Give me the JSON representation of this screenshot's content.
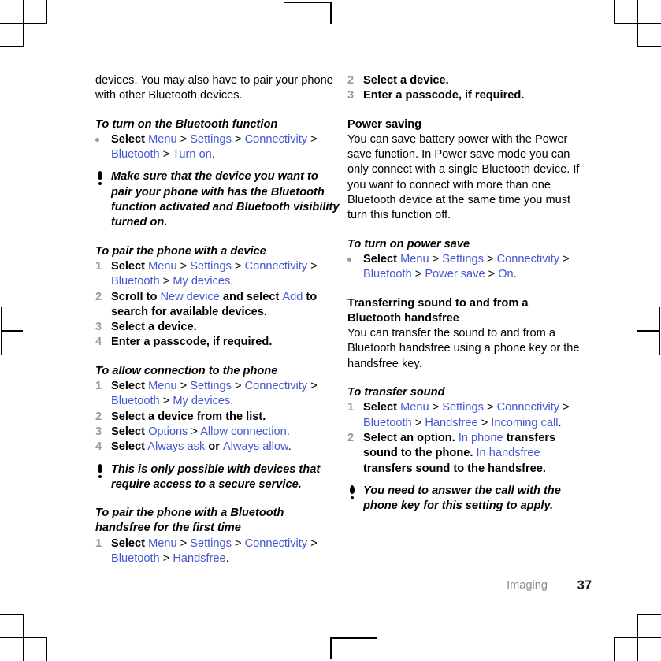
{
  "document": {
    "footer": {
      "chapter": "Imaging",
      "page_number": "37"
    },
    "colors": {
      "link": "#4257cf",
      "step_number": "#9a9a9a",
      "chapter_text": "#8c8c8c",
      "body_text": "#000000"
    }
  },
  "left_column": {
    "intro_paragraph": "devices. You may also have to pair your phone with other Bluetooth devices.",
    "section_turn_on_bluetooth": {
      "heading": "To turn on the Bluetooth function",
      "step": {
        "marker": "bullet",
        "verb": "Select",
        "path": [
          "Menu",
          "Settings",
          "Connectivity",
          "Bluetooth",
          "Turn on"
        ],
        "terminator": "."
      }
    },
    "note_visibility": "Make sure that the device you want to pair your phone with has the Bluetooth function activated and Bluetooth visibility turned on.",
    "section_pair_device": {
      "heading": "To pair the phone with a device",
      "steps": [
        {
          "number": "1",
          "verb": "Select",
          "path": [
            "Menu",
            "Settings",
            "Connectivity",
            "Bluetooth",
            "My devices"
          ],
          "terminator": "."
        },
        {
          "number": "2",
          "text_pre": "Scroll to ",
          "link_1": "New device",
          "text_mid": " and select ",
          "link_2": "Add",
          "text_post": " to search for available devices."
        },
        {
          "number": "3",
          "text": "Select a device."
        },
        {
          "number": "4",
          "text": "Enter a passcode, if required."
        }
      ]
    },
    "section_allow_connection": {
      "heading": "To allow connection to the phone",
      "steps": [
        {
          "number": "1",
          "verb": "Select",
          "path": [
            "Menu",
            "Settings",
            "Connectivity",
            "Bluetooth",
            "My devices"
          ],
          "terminator": "."
        },
        {
          "number": "2",
          "text": "Select a device from the list."
        },
        {
          "number": "3",
          "verb": "Select",
          "path": [
            "Options",
            "Allow connection"
          ],
          "terminator": "."
        },
        {
          "number": "4",
          "verb": "Select",
          "link_1": "Always ask",
          "conjunction": " or ",
          "link_2": "Always allow",
          "terminator": "."
        }
      ]
    },
    "note_secure_service": "This is only possible with devices that require access to a secure service.",
    "section_pair_handsfree": {
      "heading_line_1": "To pair the phone with a Bluetooth",
      "heading_line_2": "handsfree for the first time",
      "steps": [
        {
          "number": "1",
          "verb": "Select",
          "path": [
            "Menu",
            "Settings",
            "Connectivity",
            "Bluetooth",
            "Handsfree"
          ],
          "terminator": "."
        }
      ]
    }
  },
  "right_column": {
    "continued_steps": [
      {
        "number": "2",
        "text": "Select a device."
      },
      {
        "number": "3",
        "text": "Enter a passcode, if required."
      }
    ],
    "section_power_saving": {
      "heading": "Power saving",
      "body": "You can save battery power with the Power save function. In Power save mode you can only connect with a single Bluetooth device. If you want to connect with more than one Bluetooth device at the same time you must turn this function off."
    },
    "section_turn_on_power_save": {
      "heading": "To turn on power save",
      "step": {
        "marker": "bullet",
        "verb": "Select",
        "path": [
          "Menu",
          "Settings",
          "Connectivity",
          "Bluetooth",
          "Power save",
          "On"
        ],
        "terminator": "."
      }
    },
    "section_transferring_sound": {
      "heading_line_1": "Transferring sound to and from a",
      "heading_line_2": "Bluetooth handsfree",
      "body": "You can transfer the sound to and from a Bluetooth handsfree using a phone key or the handsfree key."
    },
    "section_transfer_sound": {
      "heading": "To transfer sound",
      "steps": [
        {
          "number": "1",
          "verb": "Select",
          "path": [
            "Menu",
            "Settings",
            "Connectivity",
            "Bluetooth",
            "Handsfree",
            "Incoming call"
          ],
          "terminator": "."
        },
        {
          "number": "2",
          "text_pre": "Select an option. ",
          "link_1": "In phone",
          "text_mid": " transfers sound to the phone. ",
          "link_2": "In handsfree",
          "text_post": " transfers sound to the handsfree."
        }
      ]
    },
    "note_answer_call": "You need to answer the call with the phone key for this setting to apply."
  }
}
